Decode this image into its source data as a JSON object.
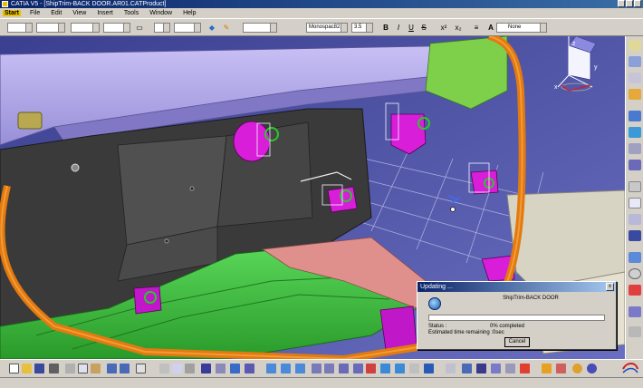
{
  "window": {
    "title": "CATIA V5 - [ShipTrim-BACK DOOR.AR01.CATProduct]"
  },
  "menu": {
    "items": [
      "Start",
      "File",
      "Edit",
      "View",
      "Insert",
      "Tools",
      "Window",
      "Help"
    ]
  },
  "format_toolbar": {
    "font_name": "Monospac821",
    "font_size": "3.5",
    "bold": "B",
    "italic": "I",
    "underline": "U",
    "strike": "S",
    "superscript": "x²",
    "subscript": "x₂",
    "frame_label": "None",
    "frame_letter": "A"
  },
  "dialog": {
    "title": "Updating ...",
    "document": "ShipTrim-BACK DOOR",
    "progress_percent": 0,
    "status_label": "Status :",
    "status_value": "0% completed",
    "estimated": "Estimated time remaining :0sec",
    "cancel_label": "Cancel",
    "close_label": "x"
  },
  "compass_axes": {
    "x": "x",
    "y": "y",
    "z": "z"
  },
  "colors": {
    "viewport_background": "#4a4ea0",
    "door_frame": "#e27a10",
    "carpet": "#3cbe3c",
    "hidden_panel": "#b0a8e8",
    "clip_parts": "#d81ed8",
    "progress_fill": "#0a246a"
  },
  "icons": {
    "right_toolbar": [
      "catalog-icon",
      "compass-icon",
      "shape-icon",
      "tree-icon",
      "fit-icon",
      "plane-icon",
      "sphere-icon",
      "lock-icon",
      "constraint-icon",
      "link-icon",
      "measure-icon",
      "text-icon",
      "sketch-icon",
      "circle-icon",
      "hook-icon",
      "pencil-icon"
    ],
    "bottom_toolbar": [
      "new-icon",
      "open-icon",
      "save-icon",
      "print-icon",
      "cut-icon",
      "copy-icon",
      "paste-icon",
      "undo-icon",
      "redo-icon",
      "help-icon",
      "formula-icon",
      "comment-icon",
      "table-icon",
      "search-icon",
      "knowledge-icon",
      "pan-icon",
      "rotate-icon",
      "zoom-in-icon",
      "zoom-out-icon",
      "normal-view-icon",
      "multi-view-icon",
      "iso-view-icon",
      "shading-icon",
      "hide-show-icon",
      "swap-icon",
      "render-icon",
      "light-icon",
      "material-icon",
      "apply-icon",
      "catia-icon"
    ]
  }
}
